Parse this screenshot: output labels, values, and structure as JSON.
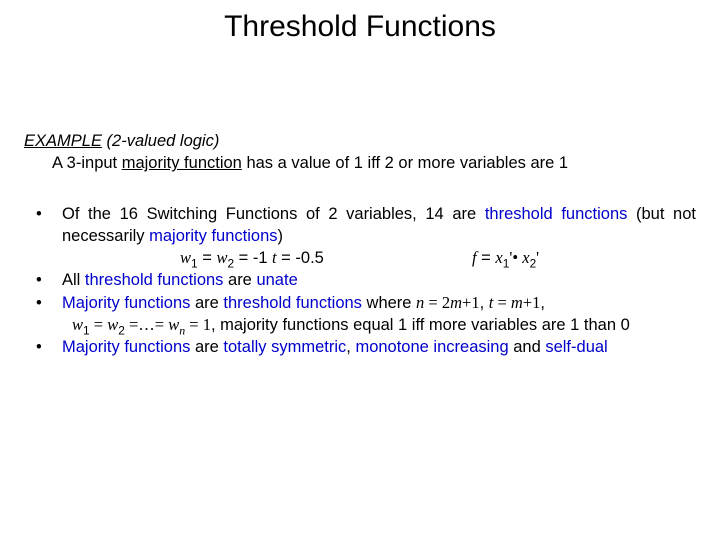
{
  "title": "Threshold Functions",
  "example": {
    "label": "EXAMPLE",
    "paren": " (2-valued logic)",
    "line": "A 3-input ",
    "majority_function": "majority function",
    "line_rest": " has a value of 1 iff 2 or more variables are 1"
  },
  "bullets": {
    "b1a": "Of the 16 Switching Functions of 2 variables, 14 are ",
    "b1_thresh": "threshold functions",
    "b1b": " (but not necessarily ",
    "b1_major": "majority functions",
    "b1c": ")",
    "eq_w": "w",
    "eq_row1_left_a": " = ",
    "eq_row1_left_b": " = -1",
    "eq_row1_mid_a": "t",
    "eq_row1_mid_b": " = -0.5",
    "eq_row1_right_a": "f",
    "eq_row1_right_b": " = ",
    "eq_row1_right_c": "x",
    "eq_row1_right_prime": "'",
    "eq_row1_right_dot": "• ",
    "b2a": "All ",
    "b2_thresh": "threshold functions ",
    "b2b": " are ",
    "b2_unate": "unate",
    "b3_major": "Majority functions",
    "b3a": " are ",
    "b3_thresh": "threshold functions",
    "b3b": " where ",
    "b3_eq1": "n",
    "b3_eq1b": " = 2",
    "b3_eq1c": "m",
    "b3_eq1d": "+1",
    "b3_comma": ", ",
    "b3_eq2a": "t",
    "b3_eq2b": " = ",
    "b3_eq2c": "m",
    "b3_eq2d": "+1",
    "b3_line2a": "w",
    "b3_line2b": " = ",
    "b3_line2c": "w",
    "b3_line2d": " =…= ",
    "b3_line2e": "w",
    "b3_line2_n": "n",
    "b3_line2f": " = 1",
    "b3_line2g": ", majority functions equal 1 iff more variables are 1 than 0",
    "b4_major": "Majority functions",
    "b4a": " are ",
    "b4_totsym": "totally symmetric",
    "b4b": ", ",
    "b4_mono": "monotone increasing",
    "b4c": " and ",
    "b4_selfdual": "self-dual"
  }
}
